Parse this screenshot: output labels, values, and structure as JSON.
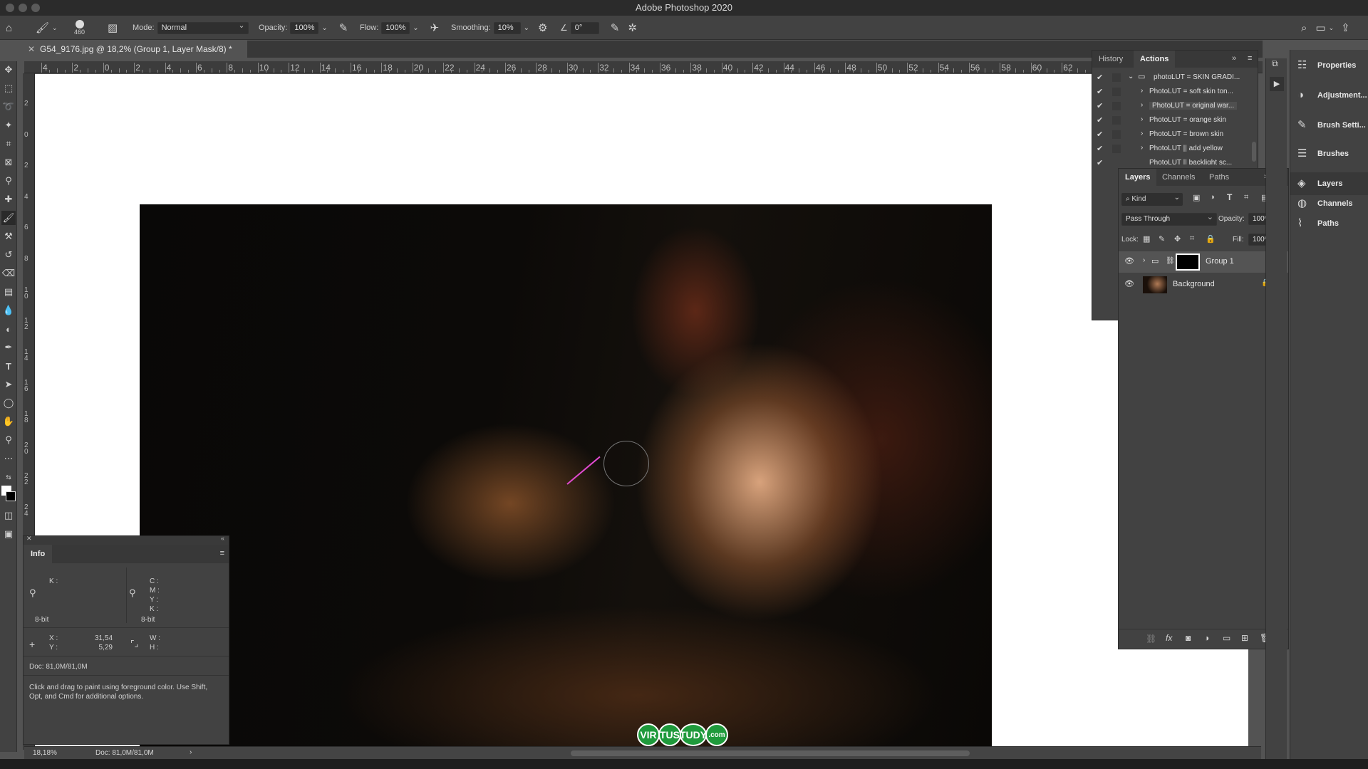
{
  "app": {
    "title": "Adobe Photoshop 2020"
  },
  "options_bar": {
    "brush_size": "460",
    "mode_label": "Mode:",
    "mode_value": "Normal",
    "opacity_label": "Opacity:",
    "opacity_value": "100%",
    "flow_label": "Flow:",
    "flow_value": "100%",
    "smoothing_label": "Smoothing:",
    "smoothing_value": "10%",
    "angle_value": "0°"
  },
  "document": {
    "tab_title": "G54_9176.jpg @ 18,2% (Group 1, Layer Mask/8) *"
  },
  "rulers": {
    "top": [
      "4",
      "2",
      "0",
      "2",
      "4",
      "6",
      "8",
      "10",
      "12",
      "14",
      "16",
      "18",
      "20",
      "22",
      "24",
      "26",
      "28",
      "30",
      "32",
      "34",
      "36",
      "38",
      "40",
      "42",
      "44",
      "46",
      "48",
      "50",
      "52",
      "54",
      "56",
      "58",
      "60",
      "62"
    ],
    "left": [
      "2",
      "0",
      "2",
      "4",
      "6",
      "8",
      "1 0",
      "1 2",
      "1 4",
      "1 6",
      "1 8",
      "2 0",
      "2 2",
      "2 4"
    ]
  },
  "info_panel": {
    "tab": "Info",
    "k1": "K :",
    "bit1": "8-bit",
    "c": "C :",
    "m": "M :",
    "y": "Y :",
    "k2": "K :",
    "bit2": "8-bit",
    "x_label": "X :",
    "x_value": "31,54",
    "y_label": "Y :",
    "y_value": "5,29",
    "w_label": "W :",
    "h_label": "H :",
    "doc": "Doc: 81,0M/81,0M",
    "hint": "Click and drag to paint using foreground color.  Use Shift, Opt, and Cmd for additional options."
  },
  "actions_panel": {
    "tabs": [
      "History",
      "Actions"
    ],
    "items": [
      "photoLUT = SKIN GRADI...",
      "PhotoLUT = soft skin ton...",
      "PhotoLUT = original war...",
      "PhotoLUT = orange skin",
      "PhotoLUT = brown skin",
      "PhotoLUT || add yellow",
      "PhotoLUT || backlight sc..."
    ]
  },
  "layers_panel": {
    "tabs": [
      "Layers",
      "Channels",
      "Paths"
    ],
    "filter_value": "Kind",
    "blend_mode": "Pass Through",
    "opacity_label": "Opacity:",
    "opacity_value": "100%",
    "lock_label": "Lock:",
    "fill_label": "Fill:",
    "fill_value": "100%",
    "layers": [
      {
        "name": "Group 1"
      },
      {
        "name": "Background"
      }
    ]
  },
  "collapsed_panels": [
    "Properties",
    "Adjustment...",
    "Brush Setti...",
    "Brushes",
    "Layers",
    "Channels",
    "Paths"
  ],
  "status_bar": {
    "zoom": "18,18%",
    "doc": "Doc: 81,0M/81,0M"
  },
  "logo": {
    "letters": [
      "VIR",
      "TUS",
      "TUDY",
      ".com"
    ]
  }
}
